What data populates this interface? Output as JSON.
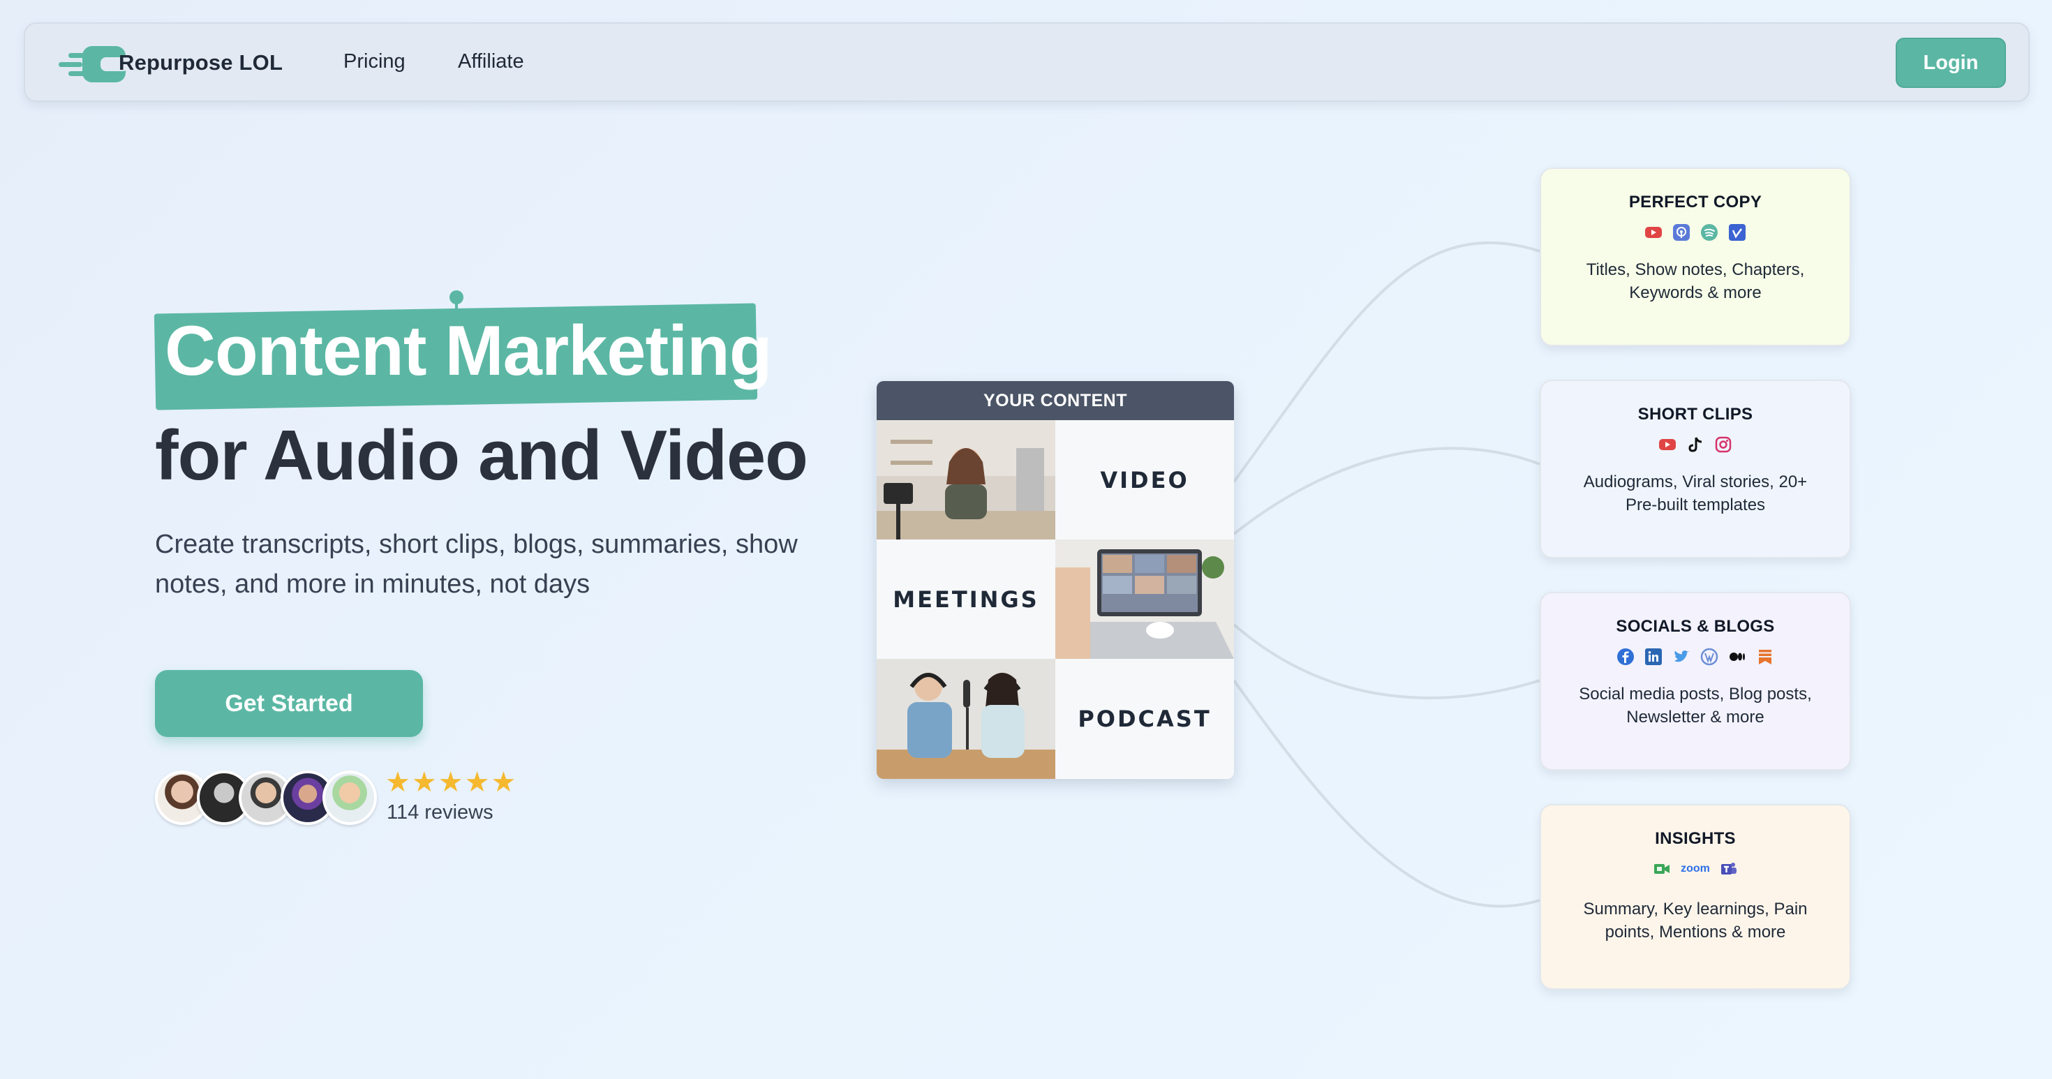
{
  "nav": {
    "brand": "Repurpose LOL",
    "links": [
      "Pricing",
      "Affiliate"
    ],
    "login_label": "Login"
  },
  "hero": {
    "title_highlight": "Content Marketing",
    "title_rest": "for Audio and Video",
    "subtitle": "Create transcripts, short clips, blogs, summaries, show notes, and more in minutes, not days",
    "cta_label": "Get Started",
    "rating": 4.5,
    "stars": "★★★★★",
    "reviews_text": "114 reviews"
  },
  "content_card": {
    "header": "YOUR CONTENT",
    "labels": {
      "video": "VIDEO",
      "meetings": "MEETINGS",
      "podcast": "PODCAST"
    }
  },
  "outputs": [
    {
      "title": "PERFECT COPY",
      "icons": [
        "youtube-icon",
        "apple-podcasts-icon",
        "spotify-icon",
        "vimeo-icon"
      ],
      "description": "Titles, Show notes, Chapters, Keywords & more",
      "bg": "#f7fde8"
    },
    {
      "title": "SHORT CLIPS",
      "icons": [
        "youtube-icon",
        "tiktok-icon",
        "instagram-icon"
      ],
      "description": "Audiograms, Viral stories, 20+ Pre-built templates",
      "bg": "#f0f5fd"
    },
    {
      "title": "SOCIALS & BLOGS",
      "icons": [
        "facebook-icon",
        "linkedin-icon",
        "twitter-icon",
        "wordpress-icon",
        "medium-icon",
        "substack-icon"
      ],
      "description": "Social media posts, Blog posts, Newsletter & more",
      "bg": "#f3f2fd"
    },
    {
      "title": "INSIGHTS",
      "icons": [
        "google-meet-icon",
        "zoom-icon",
        "teams-icon"
      ],
      "zoom_text": "zoom",
      "description": "Summary, Key learnings, Pain points, Mentions & more",
      "bg": "#fdf5ea"
    }
  ],
  "colors": {
    "accent": "#5bb7a4",
    "dark_text": "#2b323d",
    "card_header": "#4b5567"
  }
}
